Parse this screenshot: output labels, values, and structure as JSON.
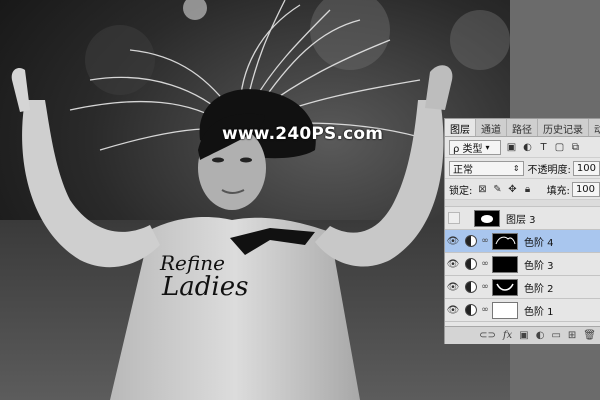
{
  "watermark": "www.240PS.com",
  "photo": {
    "shirt_text_line1": "Refine",
    "shirt_text_line2": "Ladies"
  },
  "panel": {
    "tabs": [
      "图层",
      "通道",
      "路径",
      "历史记录",
      "动作"
    ],
    "filter_label": "ρ 类型",
    "blend_mode": "正常",
    "opacity_label": "不透明度:",
    "opacity_value": "100",
    "lock_label": "锁定:",
    "fill_label": "填充:",
    "fill_value": "100",
    "layers": [
      {
        "name": "图层 3",
        "visible": false,
        "type": "pixel"
      },
      {
        "name": "色阶 4",
        "visible": true,
        "type": "adjustment",
        "selected": true
      },
      {
        "name": "色阶 3",
        "visible": true,
        "type": "adjustment"
      },
      {
        "name": "色阶 2",
        "visible": true,
        "type": "adjustment"
      },
      {
        "name": "色阶 1",
        "visible": true,
        "type": "adjustment"
      }
    ],
    "bottom_icons": [
      "link-icon",
      "fx-icon",
      "mask-icon",
      "adjustment-icon",
      "group-icon",
      "new-layer-icon",
      "trash-icon"
    ]
  }
}
